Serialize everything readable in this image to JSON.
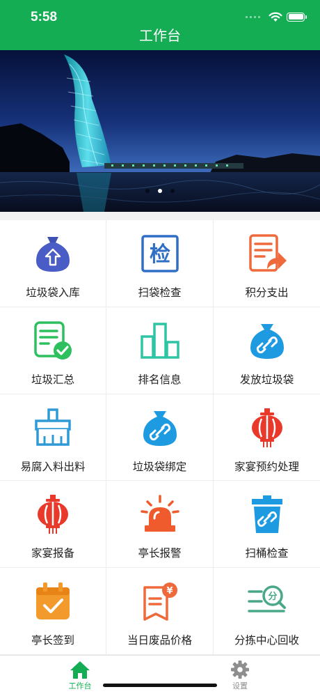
{
  "status_bar": {
    "time": "5:58"
  },
  "header": {
    "title": "工作台"
  },
  "banner": {
    "page_count": 3,
    "active_index": 1
  },
  "grid": {
    "items": [
      {
        "label": "垃圾袋入库",
        "icon": "bag-upload-icon"
      },
      {
        "label": "扫袋检查",
        "icon": "inspect-icon"
      },
      {
        "label": "积分支出",
        "icon": "document-share-icon"
      },
      {
        "label": "垃圾汇总",
        "icon": "checklist-icon"
      },
      {
        "label": "排名信息",
        "icon": "bar-chart-icon"
      },
      {
        "label": "发放垃圾袋",
        "icon": "bag-link-icon"
      },
      {
        "label": "易腐入料出料",
        "icon": "broom-icon"
      },
      {
        "label": "垃圾袋绑定",
        "icon": "bag-bind-icon"
      },
      {
        "label": "家宴预约处理",
        "icon": "lantern-icon"
      },
      {
        "label": "家宴报备",
        "icon": "lantern-report-icon"
      },
      {
        "label": "亭长报警",
        "icon": "alarm-light-icon"
      },
      {
        "label": "扫桶检查",
        "icon": "bin-check-icon"
      },
      {
        "label": "亭长签到",
        "icon": "calendar-check-icon"
      },
      {
        "label": "当日废品价格",
        "icon": "price-tag-icon"
      },
      {
        "label": "分拣中心回收",
        "icon": "sort-search-icon"
      }
    ]
  },
  "tabbar": {
    "work_label": "工作台",
    "settings_label": "设置",
    "active_color": "#14ad54",
    "inactive_color": "#8e8e8e"
  },
  "colors": {
    "brand_green": "#14ad54"
  }
}
